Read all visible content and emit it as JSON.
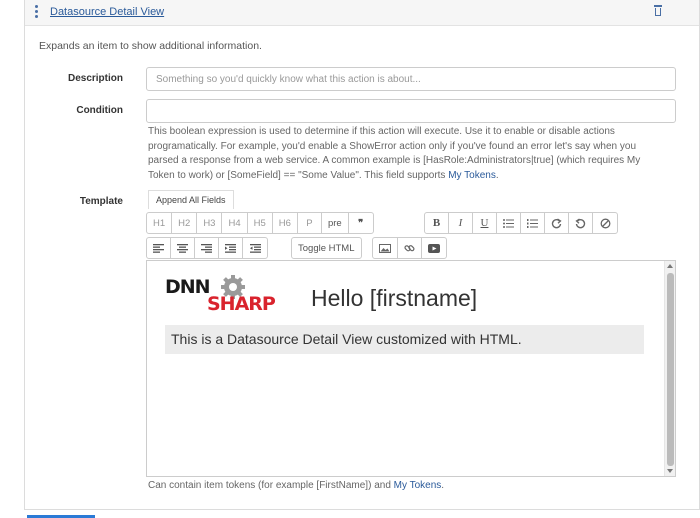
{
  "panel": {
    "title": "Datasource Detail View",
    "description": "Expands an item to show additional information."
  },
  "form": {
    "description_label": "Description",
    "description_placeholder": "Something so you'd quickly know what this action is about...",
    "condition_label": "Condition",
    "condition_value": "",
    "condition_help_text": "This boolean expression is used to determine if this action will execute. Use it to enable or disable actions programatically. For example, you'd enable a ShowError action only if you've found an error let's say when you parsed a response from a web service. A common example is [HasRole:Administrators|true] (which requires My Token to work) or [SomeField] == \"Some Value\". This field supports",
    "condition_help_link": "My Tokens",
    "condition_help_end": ".",
    "template_label": "Template",
    "append_fields_label": "Append All Fields"
  },
  "toolbar": {
    "headings": [
      "H1",
      "H2",
      "H3",
      "H4",
      "H5",
      "H6",
      "P",
      "pre",
      "❞"
    ],
    "format_icons": [
      "bold-icon",
      "italic-icon",
      "underline-icon",
      "unordered-list-icon",
      "ordered-list-icon",
      "redo-icon",
      "undo-icon",
      "clear-format-icon"
    ],
    "format_labels": {
      "bold": "B",
      "italic": "I",
      "underline": "U"
    },
    "align_icons": [
      "align-left-icon",
      "align-center-icon",
      "align-right-icon",
      "indent-icon",
      "outdent-icon"
    ],
    "toggle_html_label": "Toggle HTML",
    "media_icons": [
      "insert-image-icon",
      "insert-link-icon",
      "insert-video-icon"
    ]
  },
  "editor": {
    "logo_text_dnn": "DNN",
    "logo_text_sharp": "SHARP",
    "greeting": "Hello [firstname]",
    "info_text": "This is a Datasource Detail View customized with HTML."
  },
  "footer": {
    "help_text": "Can contain item tokens (for example [FirstName]) and",
    "help_link": "My Tokens",
    "help_end": "."
  },
  "colors": {
    "link": "#2a5a9a",
    "accent": "#2a7ad6",
    "logo_dark": "#1a1a1a",
    "logo_red": "#d9232d",
    "gear": "#9a9a9a"
  }
}
